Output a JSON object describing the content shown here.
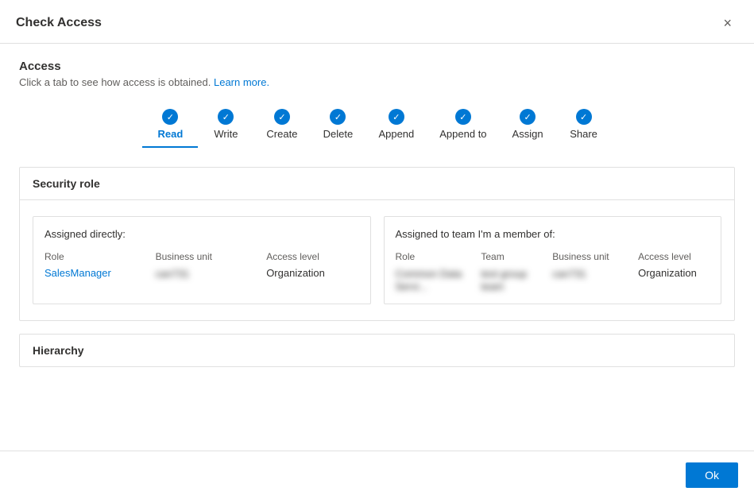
{
  "dialog": {
    "title": "Check Access",
    "close_label": "×"
  },
  "access_section": {
    "title": "Access",
    "subtitle": "Click a tab to see how access is obtained.",
    "learn_more_label": "Learn more."
  },
  "tabs": [
    {
      "id": "read",
      "label": "Read",
      "active": true
    },
    {
      "id": "write",
      "label": "Write",
      "active": false
    },
    {
      "id": "create",
      "label": "Create",
      "active": false
    },
    {
      "id": "delete",
      "label": "Delete",
      "active": false
    },
    {
      "id": "append",
      "label": "Append",
      "active": false
    },
    {
      "id": "append-to",
      "label": "Append to",
      "active": false
    },
    {
      "id": "assign",
      "label": "Assign",
      "active": false
    },
    {
      "id": "share",
      "label": "Share",
      "active": false
    }
  ],
  "security_role_section": {
    "title": "Security role",
    "assigned_directly": {
      "label": "Assigned directly:",
      "columns": {
        "role": "Role",
        "business_unit": "Business unit",
        "access_level": "Access level"
      },
      "row": {
        "role_part1": "Sales",
        "role_part2": "Manager",
        "business_unit": "can731",
        "access_level": "Organization"
      }
    },
    "assigned_team": {
      "label": "Assigned to team I'm a member of:",
      "columns": {
        "role": "Role",
        "team": "Team",
        "business_unit": "Business unit",
        "access_level": "Access level"
      },
      "row": {
        "role": "Common Data Servi...",
        "team": "test group team",
        "business_unit": "can731",
        "access_level": "Organization"
      }
    }
  },
  "hierarchy_section": {
    "title": "Hierarchy"
  },
  "footer": {
    "ok_label": "Ok"
  }
}
